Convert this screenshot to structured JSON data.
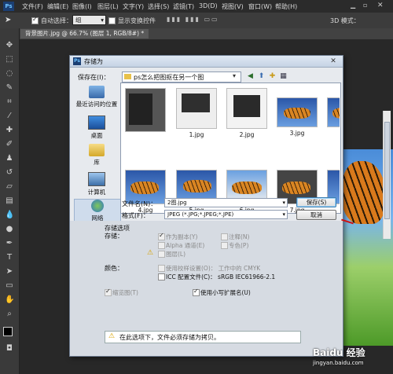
{
  "menubar": {
    "logo": "Ps",
    "items": [
      "文件(F)",
      "编辑(E)",
      "图像(I)",
      "图层(L)",
      "文字(Y)",
      "选择(S)",
      "滤镜(T)",
      "3D(D)",
      "视图(V)",
      "窗口(W)",
      "帮助(H)"
    ]
  },
  "options_bar": {
    "auto_select_label": "自动选择：",
    "auto_select_value": "组",
    "show_transform_label": "显示变换控件",
    "mode_3d_label": "3D 模式："
  },
  "document_tab": {
    "title": "背景图片.jpg @ 66.7% (图层 1, RGB/8#) *"
  },
  "dialog": {
    "title": "存储为",
    "save_in_label": "保存在(I)：",
    "save_in_value": "ps怎么把图抠在另一个图",
    "places": [
      {
        "label": "最近访问的位置",
        "icon": "recent-places-icon"
      },
      {
        "label": "桌面",
        "icon": "desktop-icon"
      },
      {
        "label": "库",
        "icon": "libraries-icon"
      },
      {
        "label": "计算机",
        "icon": "computer-icon"
      },
      {
        "label": "网络",
        "icon": "network-icon"
      }
    ],
    "files": [
      "",
      "1.jpg",
      "2.jpg",
      "3.jpg",
      "4.jpg",
      "5.jpg",
      "6.jpg",
      "7.jpg",
      "8.jpg"
    ],
    "filename_label": "文件名(N)：",
    "filename_value": "2图.jpg",
    "format_label": "格式(F)：",
    "format_value": "JPEG (*.JPG;*.JPEG;*.JPE)",
    "save_button": "保存(S)",
    "cancel_button": "取消",
    "save_options_label": "存储选项",
    "storage_label": "存储：",
    "options": {
      "as_copy": "作为副本(Y)",
      "notes": "注释(N)",
      "alpha": "Alpha 通道(E)",
      "spot_colors": "专色(P)",
      "layers": "图层(L)"
    },
    "color_label": "颜色：",
    "proof_setup": "使用校样设置(O)：  工作中的 CMYK",
    "icc_profile": "ICC 配置文件(C)：  sRGB IEC61966-2.1",
    "thumbnail": "缩览图(T)",
    "lowercase_ext": "使用小写扩展名(U)",
    "warning": "在此选项下，文件必须存储为拷贝。"
  },
  "watermark": {
    "brand": "Baidu 经验",
    "url": "jingyan.baidu.com"
  },
  "colors": {
    "menubar_bg": "#2b2b2b",
    "dialog_bg": "#e7eaee",
    "arrow": "#d01010"
  }
}
